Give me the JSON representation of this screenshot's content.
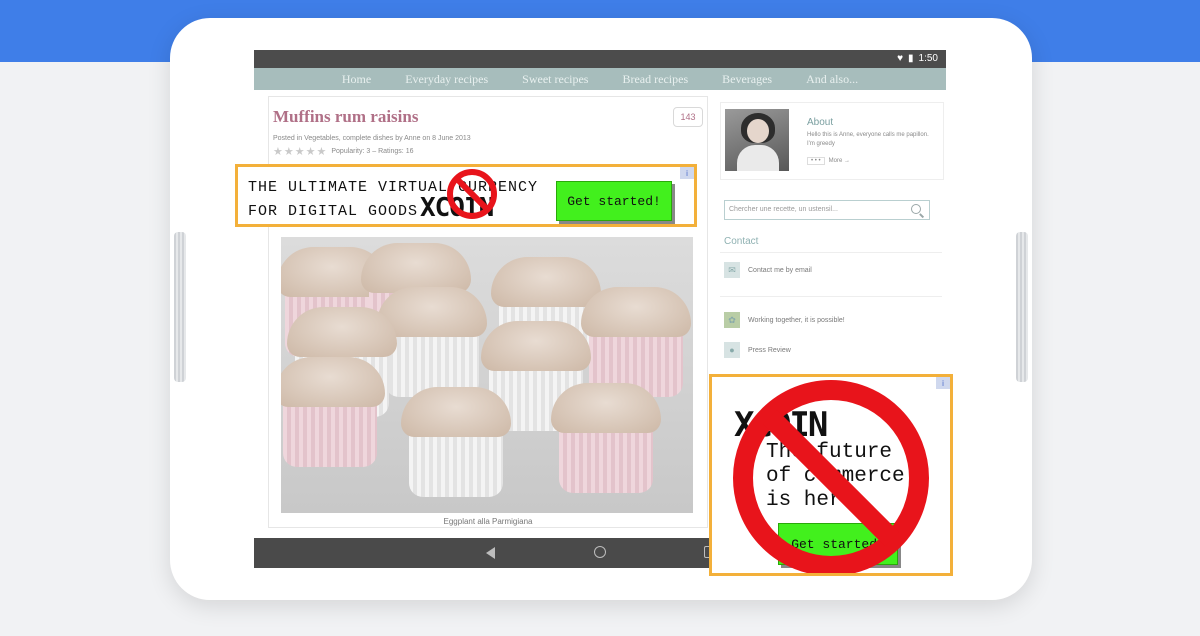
{
  "status_bar": {
    "time": "1:50"
  },
  "nav": {
    "items": [
      "Home",
      "Everyday recipes",
      "Sweet recipes",
      "Bread recipes",
      "Beverages",
      "And also..."
    ]
  },
  "post": {
    "title": "Muffins rum raisins",
    "meta": "Posted in Vegetables, complete dishes by Anne on 8 June 2013",
    "rating_text": "Popularity: 3 – Ratings: 16",
    "comment_count": "143",
    "caption": "Eggplant alla Parmigiana"
  },
  "sidebar": {
    "about_title": "About",
    "about_text": "Hello this is Anne, everyone calls me papillon. I'm greedy",
    "more_dots": "• • •",
    "more_label": "More →",
    "search_placeholder": "Chercher une recette, un ustensil...",
    "contact_title": "Contact",
    "contact_email": "Contact me by email",
    "working_together": "Working together, it is possible!",
    "press_review": "Press Review"
  },
  "ad_top": {
    "line1": "THE ULTIMATE VIRTUAL CURRENCY",
    "line2": "FOR DIGITAL GOODS",
    "logo": "XCOIN",
    "button": "Get started!",
    "badge": "i"
  },
  "ad_side": {
    "logo": "XCOIN",
    "text": "The future\nof commerce\nis here.",
    "button": "Get started!",
    "badge": "i"
  },
  "colors": {
    "accent_blue": "#3f7ee8",
    "ad_border": "#f3b03a",
    "ad_button": "#42f01d",
    "no_sign_red": "#e8141b"
  }
}
